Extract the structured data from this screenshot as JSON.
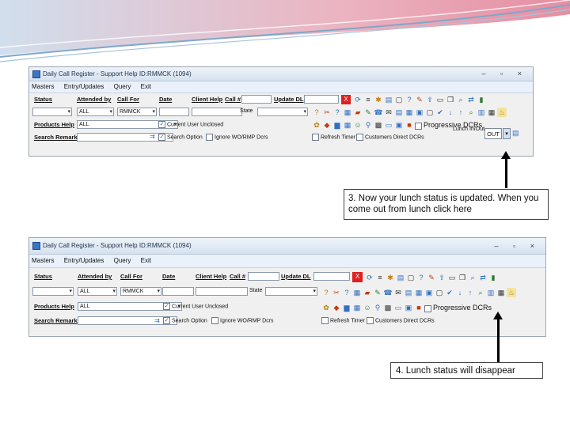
{
  "window": {
    "title": "Daily Call Register - Support Help ID:RMMCK (1094)",
    "controls": "– ▫ ×"
  },
  "menu": [
    "Masters",
    "Entry/Updates",
    "Query",
    "Exit"
  ],
  "form": {
    "status_label": "Status",
    "attended_by_label": "Attended by",
    "call_for_label": "Call For",
    "date_label": "Date",
    "client_help_label": "Client Help",
    "call_no_label": "Call #",
    "update_dl_label": "Update DL",
    "state_label": "State",
    "products_help_label": "Products Help",
    "search_remark_label": "Search Remark",
    "attended_by_value": "ALL",
    "call_for_value": "RMMCK",
    "products_value": "ALL",
    "red_button": "X",
    "current_user_unclosed": "Current User Unclosed",
    "search_option": "Search Option",
    "ignore_option": "Ignore WO/RMP Dcrs",
    "refresh_timer": "Refresh Timer",
    "customers_direct": "Customers Direct DCRs",
    "progressive": "Progressive DCRs",
    "lunch_label": "Lunch In/Out",
    "out_button": "OUT"
  },
  "callouts": {
    "step3": "3. Now your lunch status is updated. When you come out from lunch click here",
    "step4": "4. Lunch status will disappear"
  },
  "colors": {
    "accent_red": "#e02020",
    "deco_blue": "#7fa7c9",
    "deco_pink": "#e48a9e"
  }
}
